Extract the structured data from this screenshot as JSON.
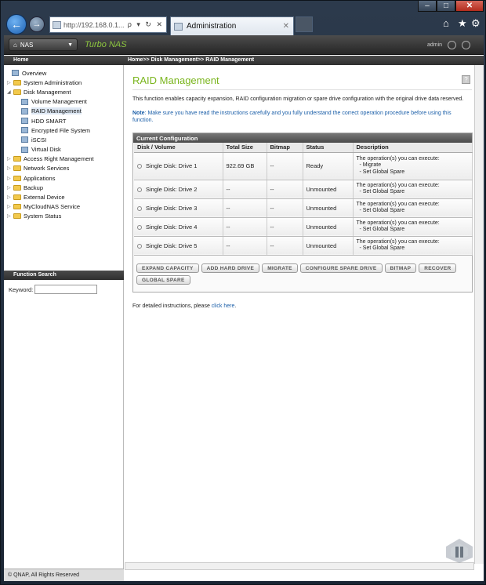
{
  "browser": {
    "address": "http://192.168.0.1...",
    "address_tail": "ρ ▾ ↻ ✕",
    "tab_title": "Administration",
    "window_controls": [
      "–",
      "□",
      "✕"
    ]
  },
  "header": {
    "nas_button": "NAS",
    "brand": "Turbo NAS",
    "user": "admin"
  },
  "crumbs": {
    "home": "Home",
    "path": "Home>> Disk Management>> RAID Management"
  },
  "sidebar": {
    "items": [
      {
        "label": "Overview",
        "level": 0,
        "type": "leaf"
      },
      {
        "label": "System Administration",
        "level": 0,
        "type": "folder"
      },
      {
        "label": "Disk Management",
        "level": 0,
        "type": "folder-open"
      },
      {
        "label": "Volume Management",
        "level": 1,
        "type": "leaf"
      },
      {
        "label": "RAID Management",
        "level": 1,
        "type": "leaf",
        "selected": true
      },
      {
        "label": "HDD SMART",
        "level": 1,
        "type": "leaf"
      },
      {
        "label": "Encrypted File System",
        "level": 1,
        "type": "leaf"
      },
      {
        "label": "iSCSI",
        "level": 1,
        "type": "leaf"
      },
      {
        "label": "Virtual Disk",
        "level": 1,
        "type": "leaf"
      },
      {
        "label": "Access Right Management",
        "level": 0,
        "type": "folder"
      },
      {
        "label": "Network Services",
        "level": 0,
        "type": "folder"
      },
      {
        "label": "Applications",
        "level": 0,
        "type": "folder"
      },
      {
        "label": "Backup",
        "level": 0,
        "type": "folder"
      },
      {
        "label": "External Device",
        "level": 0,
        "type": "folder"
      },
      {
        "label": "MyCloudNAS Service",
        "level": 0,
        "type": "folder"
      },
      {
        "label": "System Status",
        "level": 0,
        "type": "folder"
      }
    ],
    "function_search": "Function Search",
    "keyword_label": "Keyword:",
    "footer": "© QNAP, All Rights Reserved"
  },
  "main": {
    "title": "RAID Management",
    "description": "This function enables capacity expansion, RAID configuration migration or spare drive configuration with the original drive data reserved.",
    "note_label": "Note",
    "note_text": ": Make sure you have read the instructions carefully and you fully understand the correct operation procedure before using this function.",
    "config_title": "Current Configuration",
    "columns": [
      "Disk / Volume",
      "Total Size",
      "Bitmap",
      "Status",
      "Description"
    ],
    "rows": [
      {
        "disk": "Single Disk: Drive 1",
        "size": "922.69 GB",
        "bitmap": "--",
        "status": "Ready",
        "desc": "The operation(s) you can execute:",
        "ops": [
          "- Migrate",
          "- Set Global Spare"
        ]
      },
      {
        "disk": "Single Disk: Drive 2",
        "size": "--",
        "bitmap": "--",
        "status": "Unmounted",
        "desc": "The operation(s) you can execute:",
        "ops": [
          "- Set Global Spare"
        ]
      },
      {
        "disk": "Single Disk: Drive 3",
        "size": "--",
        "bitmap": "--",
        "status": "Unmounted",
        "desc": "The operation(s) you can execute:",
        "ops": [
          "- Set Global Spare"
        ]
      },
      {
        "disk": "Single Disk: Drive 4",
        "size": "--",
        "bitmap": "--",
        "status": "Unmounted",
        "desc": "The operation(s) you can execute:",
        "ops": [
          "- Set Global Spare"
        ]
      },
      {
        "disk": "Single Disk: Drive 5",
        "size": "--",
        "bitmap": "--",
        "status": "Unmounted",
        "desc": "The operation(s) you can execute:",
        "ops": [
          "- Set Global Spare"
        ]
      }
    ],
    "buttons": [
      "EXPAND CAPACITY",
      "ADD HARD DRIVE",
      "MIGRATE",
      "CONFIGURE SPARE DRIVE",
      "BITMAP",
      "RECOVER",
      "GLOBAL SPARE"
    ],
    "instructions_prefix": "For detailed instructions, please ",
    "instructions_link": "click here",
    "instructions_suffix": "."
  },
  "colors": {
    "accent": "#7ab51d",
    "link": "#1a5ea8"
  }
}
